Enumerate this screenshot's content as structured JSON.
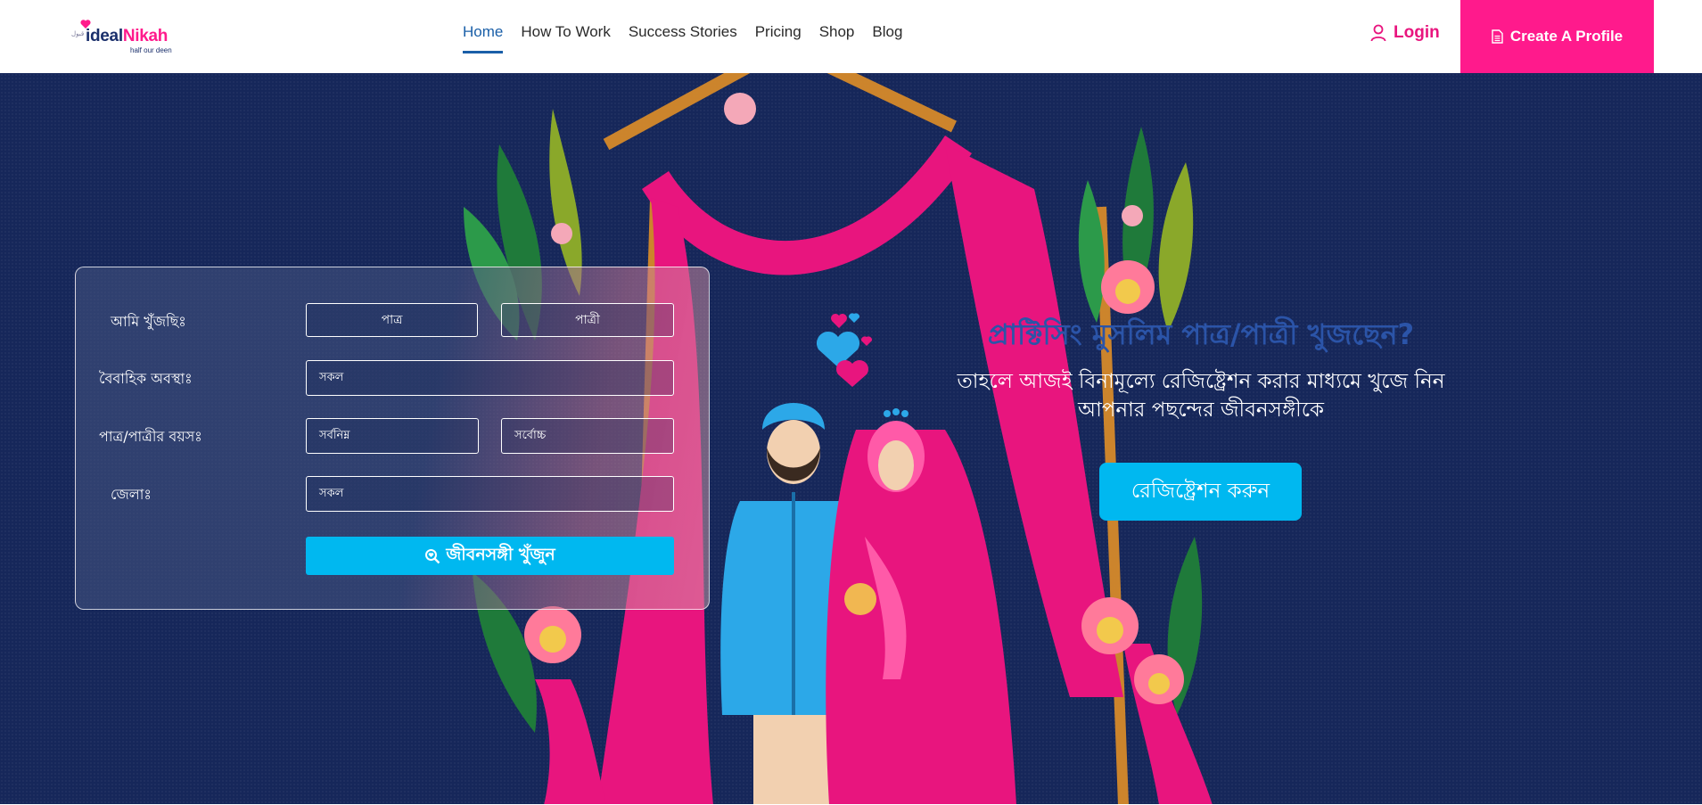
{
  "brand": {
    "mark_text": "قبول",
    "name_part1": "ideal",
    "name_part2": "Nikah",
    "tagline": "half our deen",
    "pink": "#ff1a8c",
    "navy": "#1a2f6b"
  },
  "nav": {
    "items": [
      {
        "label": "Home",
        "active": true
      },
      {
        "label": "How To Work",
        "active": false
      },
      {
        "label": "Success Stories",
        "active": false
      },
      {
        "label": "Pricing",
        "active": false
      },
      {
        "label": "Shop",
        "active": false
      },
      {
        "label": "Blog",
        "active": false
      }
    ]
  },
  "header": {
    "login_label": "Login",
    "login_icon": "user-icon",
    "create_label": "Create A Profile",
    "create_icon": "document-icon"
  },
  "search": {
    "looking_for_label": "আমি খুঁজছিঃ",
    "option_groom": "পাত্র",
    "option_bride": "পাত্রী",
    "marital_label": "বৈবাহিক অবস্থাঃ",
    "marital_value": "সকল",
    "age_label": "পাত্র/পাত্রীর বয়সঃ",
    "age_min": "সর্বনিম্ন",
    "age_max": "সর্বোচ্চ",
    "district_label": "জেলাঃ",
    "district_value": "সকল",
    "button_label": "জীবনসঙ্গী খুঁজুন",
    "button_icon": "search-heart-icon",
    "button_color": "#00b8f0"
  },
  "hero": {
    "headline": "প্রাক্টিসিং মুসলিম পাত্র/পাত্রী খুজছেন?",
    "subline_1": "তাহলে আজই বিনামূল্যে রেজিষ্ট্রেশন করার মাধ্যমে খুজে নিন",
    "subline_2": "আপনার পছন্দের জীবনসঙ্গীকে",
    "register_label": "রেজিষ্ট্রেশন করুন",
    "background_color": "#16275a"
  }
}
